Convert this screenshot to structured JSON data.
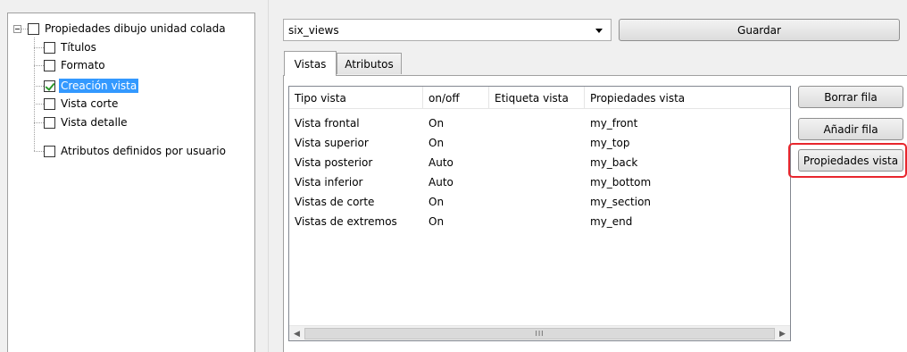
{
  "tree": {
    "root": {
      "label": "Propiedades dibujo unidad colada",
      "checked": false
    },
    "items": [
      {
        "label": "Títulos",
        "checked": false,
        "selected": false
      },
      {
        "label": "Formato",
        "checked": false,
        "selected": false
      },
      {
        "label": "Creación vista",
        "checked": true,
        "selected": true
      },
      {
        "label": "Vista corte",
        "checked": false,
        "selected": false
      },
      {
        "label": "Vista detalle",
        "checked": false,
        "selected": false
      },
      {
        "label": "Atributos definidos por usuario",
        "checked": false,
        "selected": false
      }
    ]
  },
  "toolbar": {
    "combo_value": "six_views",
    "save_label": "Guardar"
  },
  "tabs": [
    {
      "label": "Vistas",
      "active": true
    },
    {
      "label": "Atributos",
      "active": false
    }
  ],
  "table": {
    "columns": [
      "Tipo vista",
      "on/off",
      "Etiqueta vista",
      "Propiedades vista"
    ],
    "rows": [
      [
        "Vista frontal",
        "On",
        "",
        "my_front"
      ],
      [
        "Vista superior",
        "On",
        "",
        "my_top"
      ],
      [
        "Vista posterior",
        "Auto",
        "",
        "my_back"
      ],
      [
        "Vista inferior",
        "Auto",
        "",
        "my_bottom"
      ],
      [
        "Vistas de corte",
        "On",
        "",
        "my_section"
      ],
      [
        "Vistas de extremos",
        "On",
        "",
        "my_end"
      ]
    ]
  },
  "scrollbar": {
    "left_arrow": "◀",
    "right_arrow": "▶",
    "thumb_grip": "III"
  },
  "actions": {
    "delete_row": "Borrar fila",
    "add_row": "Añadir fila",
    "view_properties": "Propiedades vista"
  },
  "colors": {
    "selection": "#3399ff",
    "highlight": "#e8262d",
    "check": "#2b9a2b"
  }
}
